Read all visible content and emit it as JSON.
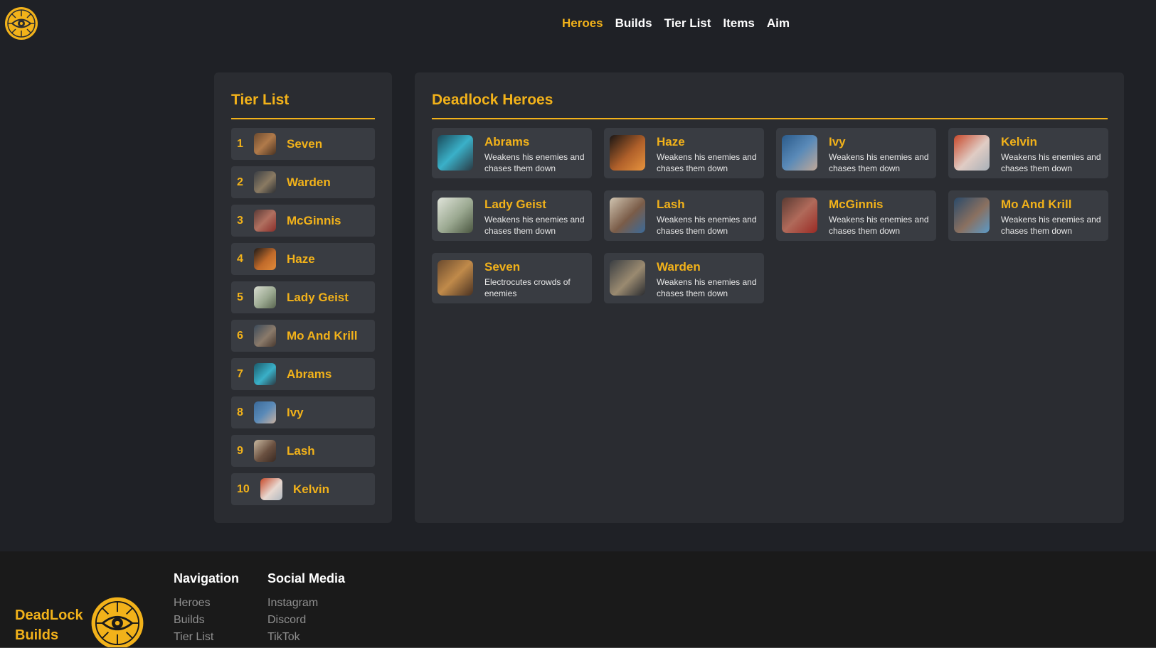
{
  "header": {
    "nav": [
      {
        "label": "Heroes",
        "active": true
      },
      {
        "label": "Builds",
        "active": false
      },
      {
        "label": "Tier List",
        "active": false
      },
      {
        "label": "Items",
        "active": false
      },
      {
        "label": "Aim",
        "active": false
      }
    ]
  },
  "tier_list": {
    "title": "Tier List",
    "items": [
      {
        "rank": "1",
        "name": "Seven"
      },
      {
        "rank": "2",
        "name": "Warden"
      },
      {
        "rank": "3",
        "name": "McGinnis"
      },
      {
        "rank": "4",
        "name": "Haze"
      },
      {
        "rank": "5",
        "name": "Lady Geist"
      },
      {
        "rank": "6",
        "name": "Mo And Krill"
      },
      {
        "rank": "7",
        "name": "Abrams"
      },
      {
        "rank": "8",
        "name": "Ivy"
      },
      {
        "rank": "9",
        "name": "Lash"
      },
      {
        "rank": "10",
        "name": "Kelvin"
      }
    ]
  },
  "heroes": {
    "title": "Deadlock Heroes",
    "cards": [
      {
        "name": "Abrams",
        "desc": "Weakens his enemies and chases them down"
      },
      {
        "name": "Haze",
        "desc": "Weakens his enemies and chases them down"
      },
      {
        "name": "Ivy",
        "desc": "Weakens his enemies and chases them down"
      },
      {
        "name": "Kelvin",
        "desc": "Weakens his enemies and chases them down"
      },
      {
        "name": "Lady Geist",
        "desc": "Weakens his enemies and chases them down"
      },
      {
        "name": "Lash",
        "desc": "Weakens his enemies and chases them down"
      },
      {
        "name": "McGinnis",
        "desc": "Weakens his enemies and chases them down"
      },
      {
        "name": "Mo And Krill",
        "desc": "Weakens his enemies and chases them down"
      },
      {
        "name": "Seven",
        "desc": "Electrocutes crowds of enemies"
      },
      {
        "name": "Warden",
        "desc": "Weakens his enemies and chases them down"
      }
    ]
  },
  "footer": {
    "brand_line1": "DeadLock",
    "brand_line2": "Builds",
    "navigation": {
      "title": "Navigation",
      "links": [
        "Heroes",
        "Builds",
        "Tier List"
      ]
    },
    "social": {
      "title": "Social Media",
      "links": [
        "Instagram",
        "Discord",
        "TikTok"
      ]
    }
  },
  "colors": {
    "accent": "#f2b21a",
    "background": "#1f2126",
    "panel": "#2a2c31",
    "card": "#393c42",
    "footer": "#1a1a1a"
  }
}
